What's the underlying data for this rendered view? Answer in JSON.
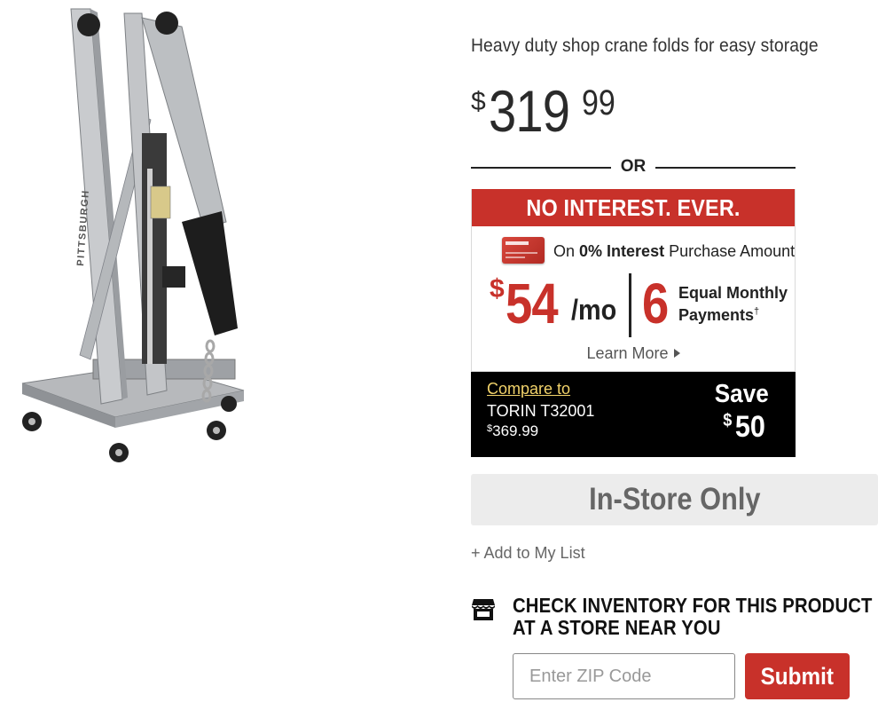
{
  "product": {
    "tagline": "Heavy duty shop crane folds for easy storage",
    "price": {
      "currency": "$",
      "dollars": "319",
      "cents": "99"
    },
    "brand_on_image": "PITTSBURGH"
  },
  "separator": {
    "label": "OR"
  },
  "financing": {
    "banner": "NO INTEREST. EVER.",
    "card_prefix": "On",
    "card_bold": "0% Interest",
    "card_suffix": "Purchase Amount",
    "currency": "$",
    "monthly_amount": "54",
    "per_month": "/mo",
    "payment_count": "6",
    "payments_line1": "Equal Monthly",
    "payments_line2": "Payments",
    "dagger": "†",
    "learn_more": "Learn More"
  },
  "compare": {
    "link_label": "Compare to",
    "competitor": "TORIN T32001",
    "currency": "$",
    "competitor_price": "369.99",
    "save_label": "Save",
    "save_amount": "50"
  },
  "availability": {
    "label": "In-Store Only"
  },
  "list": {
    "add_label": "+ Add to My List"
  },
  "inventory": {
    "line1": "CHECK INVENTORY FOR THIS PRODUCT",
    "line2": "AT A STORE NEAR YOU",
    "zip_placeholder": "Enter ZIP Code",
    "submit_label": "Submit"
  },
  "colors": {
    "accent_red": "#c8312a",
    "compare_bg": "#000000",
    "compare_link": "#f1d26a",
    "instore_bg": "#ececec"
  },
  "icons": {
    "store": "store-icon",
    "credit_card": "credit-card-icon",
    "learn_more_arrow": "caret-right-icon"
  }
}
